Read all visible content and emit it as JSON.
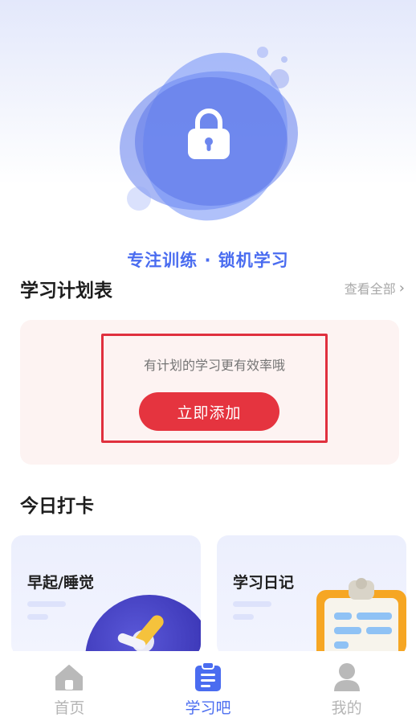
{
  "hero": {
    "slogan": "专注训练 · 锁机学习",
    "lock_icon": "lock-icon"
  },
  "plan": {
    "title": "学习计划表",
    "see_all": "查看全部",
    "hint": "有计划的学习更有效率哦",
    "add_button": "立即添加"
  },
  "checkin": {
    "title": "今日打卡",
    "cards": [
      {
        "label": "早起/睡觉",
        "icon": "clock-icon"
      },
      {
        "label": "学习日记",
        "icon": "clipboard-icon"
      }
    ]
  },
  "tabbar": {
    "items": [
      {
        "label": "首页",
        "icon": "home-icon",
        "active": false
      },
      {
        "label": "学习吧",
        "icon": "clipboard-icon",
        "active": true
      },
      {
        "label": "我的",
        "icon": "user-icon",
        "active": false
      }
    ]
  },
  "colors": {
    "accent": "#4a6cf0",
    "primary_button": "#e5343f",
    "highlight_border": "#e0303e",
    "tab_inactive": "#b5b5b5"
  }
}
